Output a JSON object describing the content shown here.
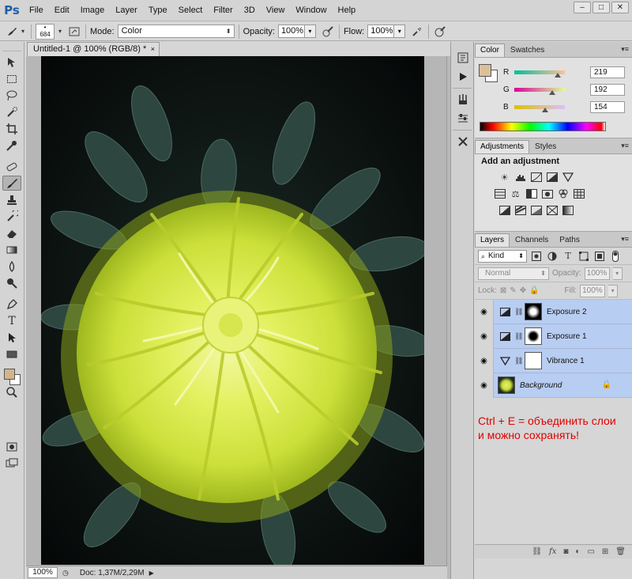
{
  "app": {
    "logo": "Ps"
  },
  "menu": [
    "File",
    "Edit",
    "Image",
    "Layer",
    "Type",
    "Select",
    "Filter",
    "3D",
    "View",
    "Window",
    "Help"
  ],
  "window_buttons": {
    "minimize": "–",
    "maximize": "□",
    "close": "✕"
  },
  "options_bar": {
    "brush_size": "684",
    "mode_label": "Mode:",
    "mode_value": "Color",
    "opacity_label": "Opacity:",
    "opacity_value": "100%",
    "flow_label": "Flow:",
    "flow_value": "100%"
  },
  "document": {
    "tab_title": "Untitled-1 @ 100% (RGB/8) *",
    "tab_close": "×",
    "zoom": "100%",
    "doc_info": "Doc: 1,37M/2,29M"
  },
  "color_panel": {
    "tabs": [
      "Color",
      "Swatches"
    ],
    "foreground": "#dbc09a",
    "channels": [
      {
        "label": "R",
        "value": "219",
        "fraction": 0.859
      },
      {
        "label": "G",
        "value": "192",
        "fraction": 0.753
      },
      {
        "label": "B",
        "value": "154",
        "fraction": 0.604
      }
    ]
  },
  "adjustments_panel": {
    "tabs": [
      "Adjustments",
      "Styles"
    ],
    "title": "Add an adjustment",
    "icons_row1": [
      "brightness-icon",
      "levels-icon",
      "curves-icon",
      "exposure-icon",
      "vibrance-icon"
    ],
    "icons_row2": [
      "hue-saturation-icon",
      "color-balance-icon",
      "black-white-icon",
      "photo-filter-icon",
      "channel-mixer-icon",
      "color-lookup-icon"
    ],
    "icons_row3": [
      "invert-icon",
      "posterize-icon",
      "threshold-icon",
      "selective-color-icon",
      "gradient-map-icon"
    ]
  },
  "layers_panel": {
    "tabs": [
      "Layers",
      "Channels",
      "Paths"
    ],
    "filter_kind": "Kind",
    "blend_mode": "Normal",
    "opacity_label": "Opacity:",
    "opacity_value": "100%",
    "lock_label": "Lock:",
    "fill_label": "Fill:",
    "fill_value": "100%",
    "layers": [
      {
        "name": "Exposure 2",
        "type": "exposure"
      },
      {
        "name": "Exposure 1",
        "type": "exposure"
      },
      {
        "name": "Vibrance 1",
        "type": "vibrance"
      },
      {
        "name": "Background",
        "type": "background"
      }
    ],
    "note_line1": "Ctrl + E = объединить слои",
    "note_line2": "и можно сохранять!"
  }
}
